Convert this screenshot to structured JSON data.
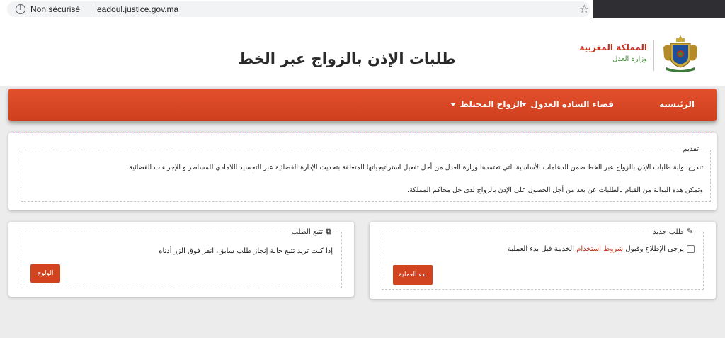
{
  "browser": {
    "security_label": "Non sécurisé",
    "url": "eadoul.justice.gov.ma",
    "info_icon": "info-icon",
    "star_icon": "bookmark-star-icon"
  },
  "header": {
    "title": "طلبات الإذن بالزواج عبر الخط",
    "kingdom": "المملكة المغربية",
    "ministry": "وزارة العدل",
    "emblem_icon": "moroccan-coat-of-arms-icon"
  },
  "nav": {
    "home": "الرئيسية",
    "adoul_space": "فضاء السادة العدول",
    "mixed_marriage": "الزواج المختلط"
  },
  "intro": {
    "legend": "تقديم",
    "p1": "تندرج بوابة طلبات الإذن بالزواج عبر الخط ضمن الدعامات الأساسية التي تعتمدها وزارة العدل من أجل تفعيل استراتيجياتها المتعلقة بتحديث الإدارة القضائية عبر التجسيد اللامادي للمساطر و الإجراءات القضائية.",
    "p2": "وتمكن هذه البوابة من القيام بالطلبات عن بعد من أجل الحصول على الإذن بالزواج لدى جل محاكم المملكة."
  },
  "track": {
    "legend": "تتبع الطلب",
    "text": "إذا كنت تريد تتبع حالة إنجاز طلب سابق، انقر فوق الزر أدناه",
    "button": "الولوج"
  },
  "new_request": {
    "legend": "طلب جديد",
    "terms_before": "يرجى الإطلاع وقبول ",
    "terms_link": "شروط استخدام",
    "terms_after": " الخدمة قبل بدء العملية",
    "button": "بدء العملية"
  },
  "colors": {
    "accent": "#d2441f",
    "kingdom_red": "#c3311e",
    "ministry_green": "#3f9233"
  }
}
